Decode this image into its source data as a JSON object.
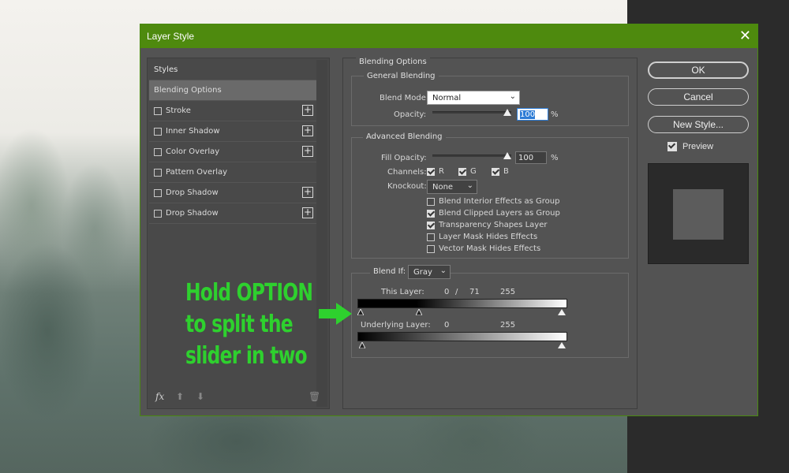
{
  "dialog": {
    "title": "Layer Style"
  },
  "styles_panel": {
    "items": [
      {
        "label": "Styles",
        "type": "heading"
      },
      {
        "label": "Blending Options",
        "type": "selected"
      },
      {
        "label": "Stroke",
        "checkbox": true,
        "add": true
      },
      {
        "label": "Inner Shadow",
        "checkbox": true,
        "add": true
      },
      {
        "label": "Color Overlay",
        "checkbox": true,
        "add": true
      },
      {
        "label": "Pattern Overlay",
        "checkbox": true,
        "add": false
      },
      {
        "label": "Drop Shadow",
        "checkbox": true,
        "add": true
      },
      {
        "label": "Drop Shadow",
        "checkbox": true,
        "add": true
      }
    ],
    "footer": {
      "fx_label": "fx"
    }
  },
  "blending": {
    "section_title": "Blending Options",
    "general": {
      "title": "General Blending",
      "blend_mode_label": "Blend Mode:",
      "blend_mode_value": "Normal",
      "opacity_label": "Opacity:",
      "opacity_value": "100",
      "opacity_unit": "%",
      "opacity_level": 1.0
    },
    "advanced": {
      "title": "Advanced Blending",
      "fill_opacity_label": "Fill Opacity:",
      "fill_opacity_value": "100",
      "fill_opacity_unit": "%",
      "fill_opacity_level": 1.0,
      "channels_label": "Channels:",
      "channel_r": "R",
      "channel_g": "G",
      "channel_b": "B",
      "knockout_label": "Knockout:",
      "knockout_value": "None",
      "options": [
        {
          "label": "Blend Interior Effects as Group",
          "checked": false
        },
        {
          "label": "Blend Clipped Layers as Group",
          "checked": true
        },
        {
          "label": "Transparency Shapes Layer",
          "checked": true
        },
        {
          "label": "Layer Mask Hides Effects",
          "checked": false
        },
        {
          "label": "Vector Mask Hides Effects",
          "checked": false
        }
      ]
    },
    "blend_if": {
      "label": "Blend If:",
      "value": "Gray",
      "this_layer_label": "This Layer:",
      "this_layer_low": "0",
      "this_layer_sep": "/",
      "this_layer_split": "71",
      "this_layer_high": "255",
      "underlying_label": "Underlying Layer:",
      "underlying_low": "0",
      "underlying_high": "255"
    }
  },
  "buttons": {
    "ok": "OK",
    "cancel": "Cancel",
    "new_style": "New Style...",
    "preview_label": "Preview"
  },
  "annotation": {
    "line1": "Hold OPTION",
    "line2": "to split the",
    "line3": "slider in two",
    "color": "#2ed12e"
  },
  "colors": {
    "titlebar": "#4e8a0e",
    "dialog_bg": "#535353"
  }
}
